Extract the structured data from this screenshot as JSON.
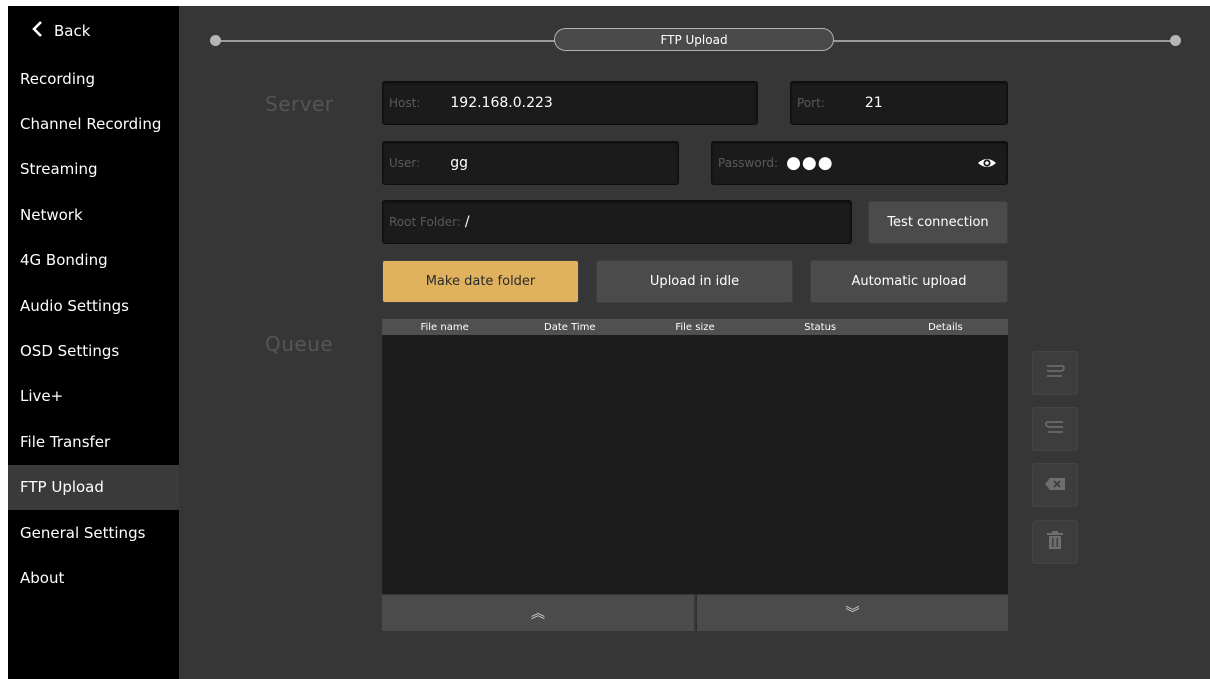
{
  "sidebar": {
    "back_label": "Back",
    "items": [
      {
        "label": "Recording"
      },
      {
        "label": "Channel Recording"
      },
      {
        "label": "Streaming"
      },
      {
        "label": "Network"
      },
      {
        "label": "4G Bonding"
      },
      {
        "label": "Audio Settings"
      },
      {
        "label": "OSD Settings"
      },
      {
        "label": "Live+"
      },
      {
        "label": "File Transfer"
      },
      {
        "label": "FTP Upload",
        "active": true
      },
      {
        "label": "General Settings"
      },
      {
        "label": "About"
      }
    ]
  },
  "header": {
    "title": "FTP Upload"
  },
  "server": {
    "section_label": "Server",
    "host_label": "Host:",
    "host_value": "192.168.0.223",
    "port_label": "Port:",
    "port_value": "21",
    "user_label": "User:",
    "user_value": "gg",
    "password_label": "Password:",
    "password_mask": "●●●",
    "root_folder_label": "Root Folder:",
    "root_folder_value": "/",
    "test_connection_label": "Test connection"
  },
  "options": {
    "make_date_folder_label": "Make date folder",
    "upload_in_idle_label": "Upload in idle",
    "automatic_upload_label": "Automatic upload"
  },
  "queue": {
    "section_label": "Queue",
    "columns": [
      "File name",
      "Date Time",
      "File size",
      "Status",
      "Details"
    ],
    "rows": [],
    "scroll_up_glyph": "︽",
    "scroll_down_glyph": "︾"
  },
  "icons": {
    "back": "chevron-left-icon",
    "show_password": "eye-icon",
    "move_up": "list-move-up-icon",
    "move_down": "list-move-down-icon",
    "remove": "backspace-icon",
    "clear": "trash-icon"
  },
  "colors": {
    "accent": "#e0b25e",
    "background": "#363636",
    "sidebar": "#000000",
    "field": "#1b1b1b"
  }
}
